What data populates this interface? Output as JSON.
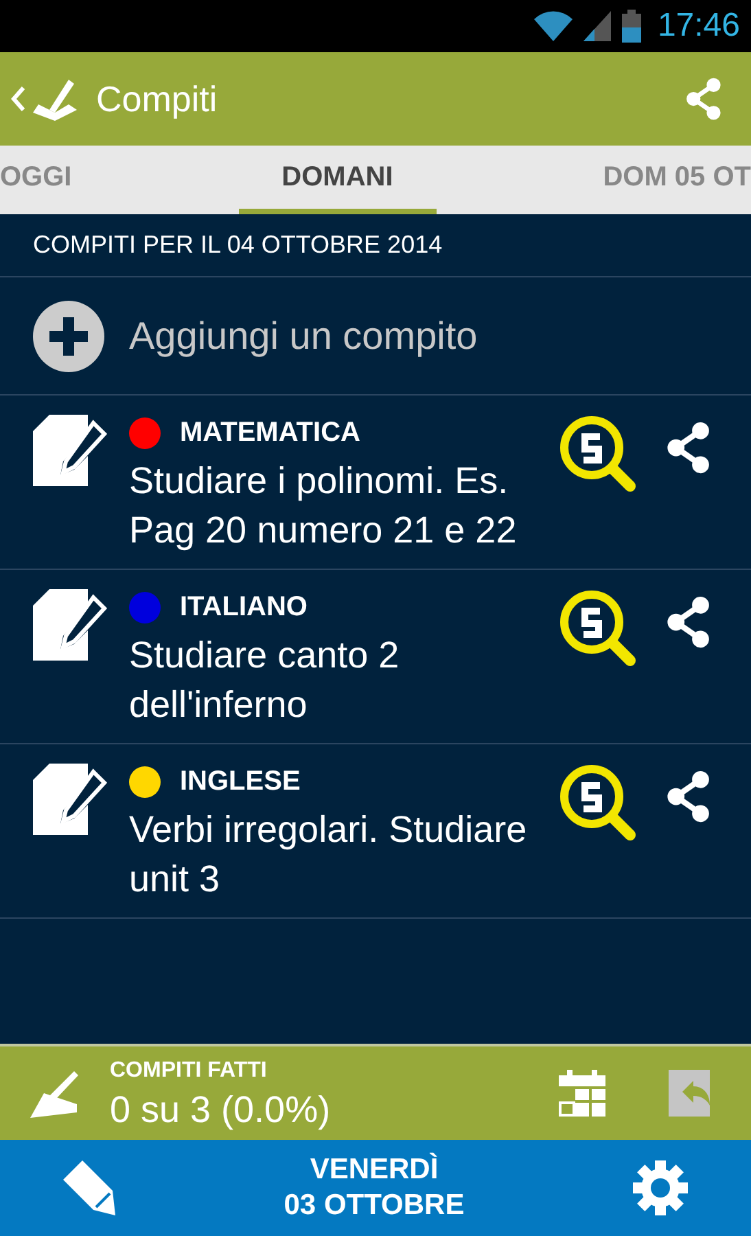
{
  "status_bar": {
    "time": "17:46"
  },
  "app_bar": {
    "title": "Compiti"
  },
  "tabs": [
    {
      "label": "OGGI",
      "selected": false
    },
    {
      "label": "DOMANI",
      "selected": true
    },
    {
      "label": "DOM 05 OT",
      "selected": false
    }
  ],
  "section_header": "COMPITI PER IL 04 OTTOBRE 2014",
  "add_row": {
    "label": "Aggiungi un compito"
  },
  "tasks": [
    {
      "subject": "MATEMATICA",
      "color": "#ff0000",
      "text": "Studiare i polinomi. Es. Pag 20 numero 21 e 22"
    },
    {
      "subject": "ITALIANO",
      "color": "#0000dd",
      "text": "Studiare canto 2 dell'inferno"
    },
    {
      "subject": "INGLESE",
      "color": "#ffd700",
      "text": "Verbi irregolari. Studiare unit 3"
    }
  ],
  "done_bar": {
    "label": "COMPITI FATTI",
    "value": "0 su 3 (0.0%)"
  },
  "bottom_bar": {
    "day": "VENERDÌ",
    "date": "03 OTTOBRE"
  }
}
